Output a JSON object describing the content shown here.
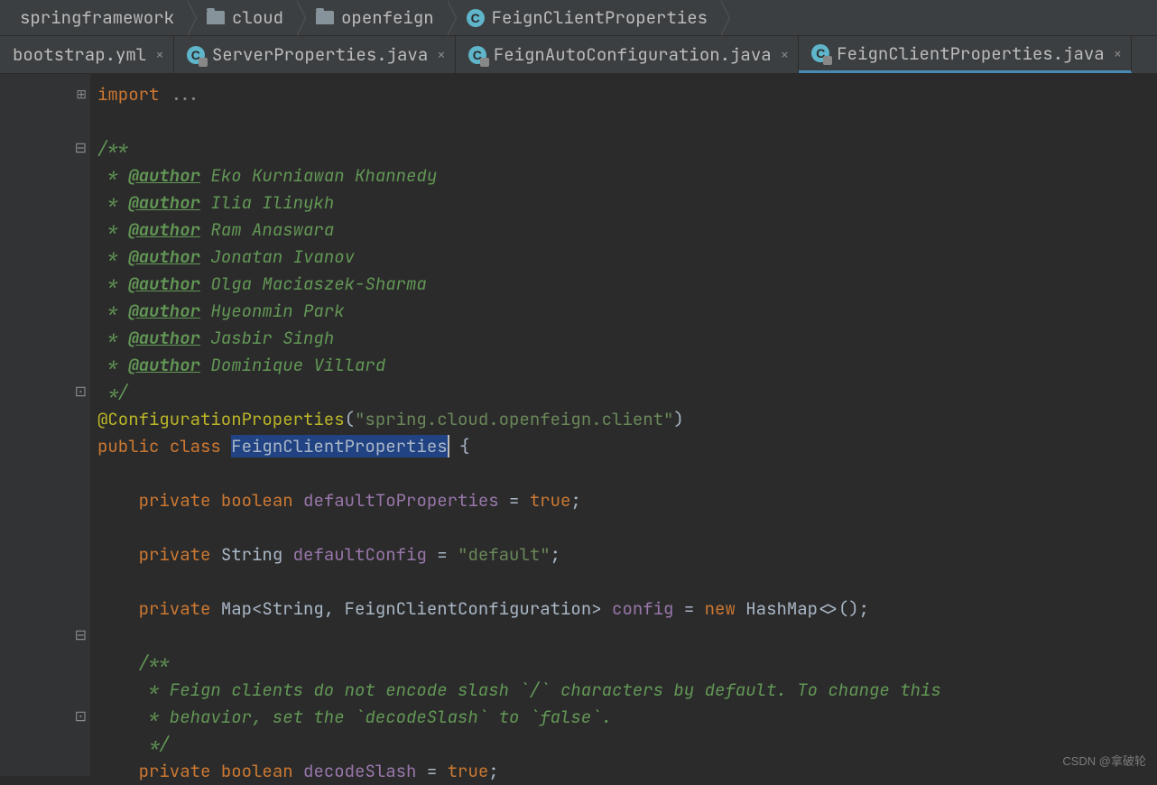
{
  "breadcrumb": [
    {
      "type": "text",
      "label": "springframework"
    },
    {
      "type": "folder",
      "label": "cloud"
    },
    {
      "type": "folder",
      "label": "openfeign"
    },
    {
      "type": "class",
      "label": "FeignClientProperties"
    }
  ],
  "tabs": [
    {
      "label": "bootstrap.yml",
      "icon": "none",
      "active": false
    },
    {
      "label": "ServerProperties.java",
      "icon": "class",
      "active": false
    },
    {
      "label": "FeignAutoConfiguration.java",
      "icon": "class",
      "active": false
    },
    {
      "label": "FeignClientProperties.java",
      "icon": "class",
      "active": true
    }
  ],
  "code": {
    "import_kw": "import",
    "import_ellipsis": "...",
    "javadoc_open": "/**",
    "authors": [
      "Eko Kurniawan Khannedy",
      "Ilia Ilinykh",
      "Ram Anaswara",
      "Jonatan Ivanov",
      "Olga Maciaszek-Sharma",
      "Hyeonmin Park",
      "Jasbir Singh",
      "Dominique Villard"
    ],
    "author_tag": "@author",
    "star": " * ",
    "javadoc_close": " */",
    "annotation": "@ConfigurationProperties",
    "annotation_value": "\"spring.cloud.openfeign.client\"",
    "class_decl_public": "public",
    "class_decl_class": "class",
    "class_name": "FeignClientProperties",
    "brace_open": " {",
    "private_kw": "private",
    "boolean_kw": "boolean",
    "field1_name": "defaultToProperties",
    "field1_val": "true",
    "string_type": "String",
    "field2_name": "defaultConfig",
    "field2_val": "\"default\"",
    "map_decl": "Map<String, FeignClientConfiguration>",
    "field3_name": "config",
    "new_kw": "new",
    "hashmap": "HashMap<>()",
    "doc2_open": "/**",
    "doc2_l1": " * Feign clients do not encode slash `/` characters by default. To change this",
    "doc2_l2": " * behavior, set the `decodeSlash` to `false`.",
    "doc2_close": " */",
    "field4_name": "decodeSlash",
    "field4_val": "true",
    "eq": " = ",
    "semicolon": ";"
  },
  "watermark": "CSDN @拿破轮"
}
